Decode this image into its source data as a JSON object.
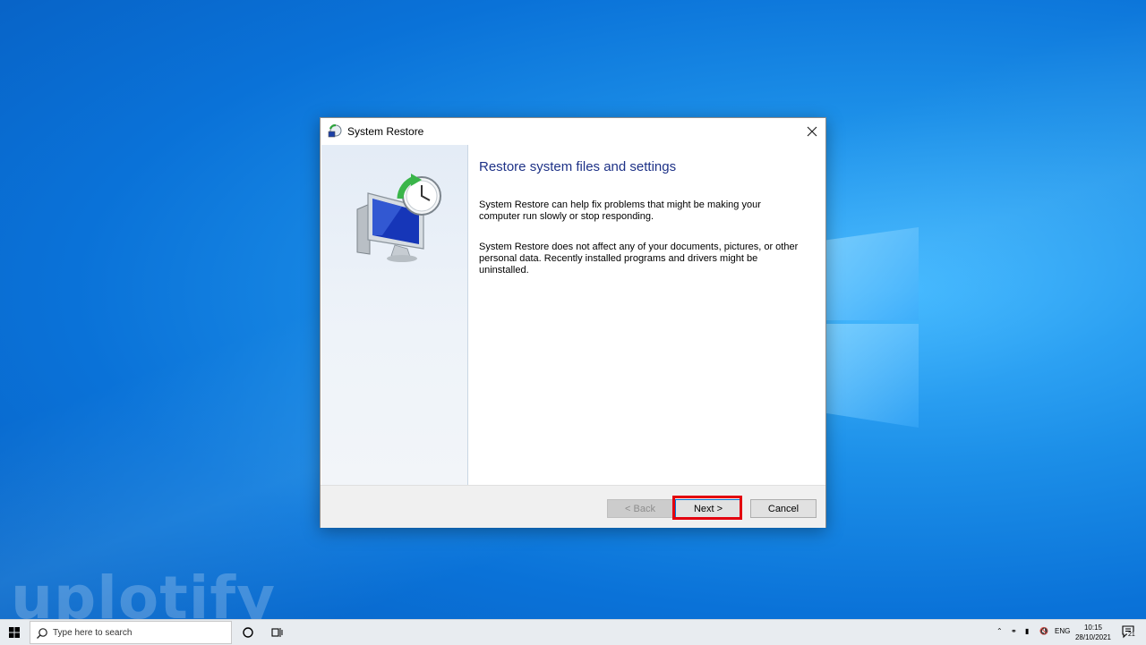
{
  "dialog": {
    "title": "System Restore",
    "heading": "Restore system files and settings",
    "paragraph1": "System Restore can help fix problems that might be making your computer run slowly or stop responding.",
    "paragraph2": "System Restore does not affect any of your documents, pictures, or other personal data. Recently installed programs and drivers might be uninstalled.",
    "buttons": {
      "back": "< Back",
      "next": "Next >",
      "cancel": "Cancel"
    },
    "close_icon": "close-icon"
  },
  "watermark": "uplotify",
  "taskbar": {
    "search_placeholder": "Type here to search",
    "tray": {
      "language": "ENG",
      "time": "10:15",
      "date": "28/10/2021",
      "notification_count": "21"
    }
  }
}
